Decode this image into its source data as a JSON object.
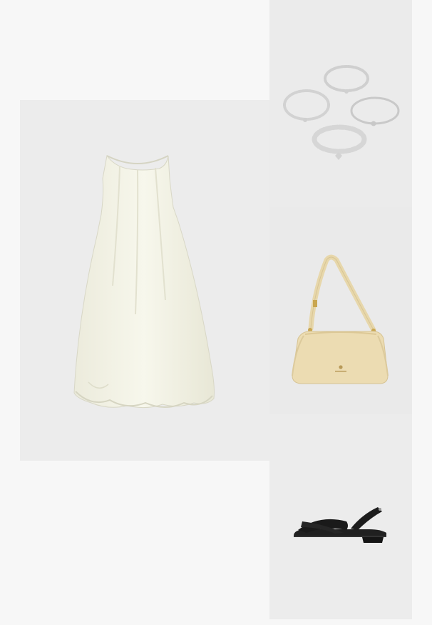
{
  "outfit": {
    "background_color": "#f7f7f7",
    "items": [
      {
        "product": "dress",
        "color_name": "off-white",
        "color": "#f4f4e6"
      },
      {
        "product": "bracelets",
        "count": 4,
        "color_name": "silver",
        "color": "#d9d9d9"
      },
      {
        "product": "shoulder-bag",
        "color_name": "beige",
        "color": "#ecdcb2"
      },
      {
        "product": "sandals",
        "color_name": "black",
        "color": "#1a1a1a"
      }
    ]
  }
}
